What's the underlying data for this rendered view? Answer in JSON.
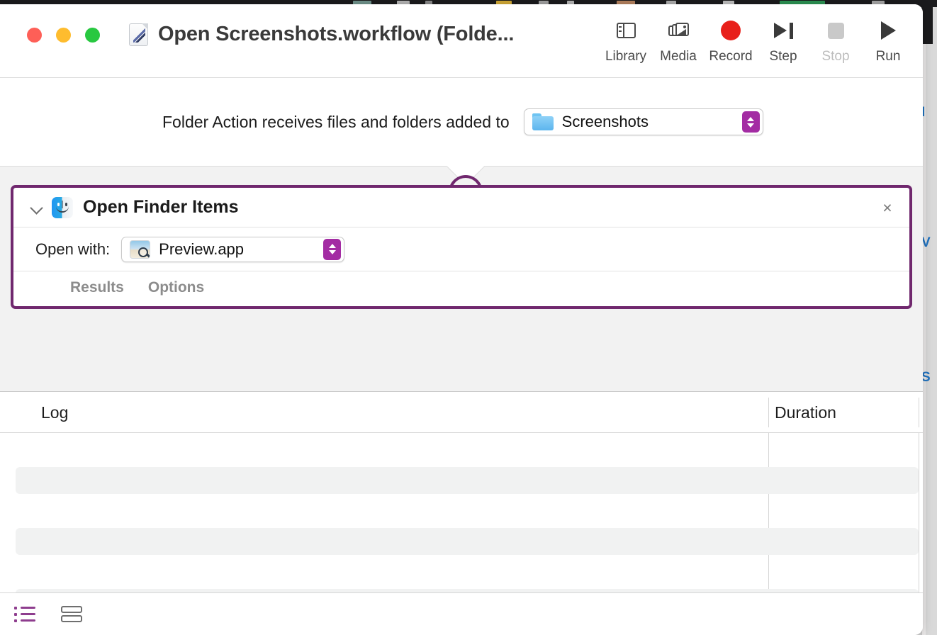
{
  "window": {
    "title": "Open Screenshots.workflow (Folde...",
    "doc_icon": "workflow-document-icon",
    "traffic_lights": [
      "close",
      "minimize",
      "zoom"
    ]
  },
  "toolbar": {
    "buttons": [
      {
        "label": "Library",
        "icon": "library-sidebar-icon",
        "disabled": false
      },
      {
        "label": "Media",
        "icon": "media-photos-icon",
        "disabled": false
      },
      {
        "label": "Record",
        "icon": "record-circle-icon",
        "disabled": false
      },
      {
        "label": "Step",
        "icon": "step-forward-icon",
        "disabled": false
      },
      {
        "label": "Stop",
        "icon": "stop-square-icon",
        "disabled": true
      },
      {
        "label": "Run",
        "icon": "run-play-icon",
        "disabled": false
      }
    ]
  },
  "receives": {
    "label": "Folder Action receives files and folders added to",
    "folder_popup": {
      "value": "Screenshots",
      "icon": "blue-folder-icon",
      "stepper": "popup-stepper-chevrons"
    }
  },
  "action": {
    "title": "Open Finder Items",
    "icon": "finder-face-icon",
    "disclosure": "chevron-down-icon",
    "close": "×",
    "open_with_label": "Open with:",
    "app_popup": {
      "value": "Preview.app",
      "icon": "preview-app-icon",
      "stepper": "popup-stepper-chevrons"
    },
    "tabs": [
      {
        "label": "Results"
      },
      {
        "label": "Options"
      }
    ],
    "accent_color": "#70286E"
  },
  "log": {
    "columns": [
      {
        "label": "Log"
      },
      {
        "label": "Duration"
      }
    ],
    "rows": []
  },
  "bottom_bar": {
    "views": [
      {
        "name": "log-list-view",
        "icon": "list-view-icon",
        "active": true
      },
      {
        "name": "split-view",
        "icon": "split-view-icon",
        "active": false
      }
    ]
  },
  "background": {
    "right_edge_text": [
      "I",
      "V",
      "S"
    ]
  },
  "colors": {
    "accent_purple": "#70286E",
    "stepper_purple": "#A32CA3",
    "record_red": "#E8201A",
    "finder_blue": "#2196F3"
  }
}
